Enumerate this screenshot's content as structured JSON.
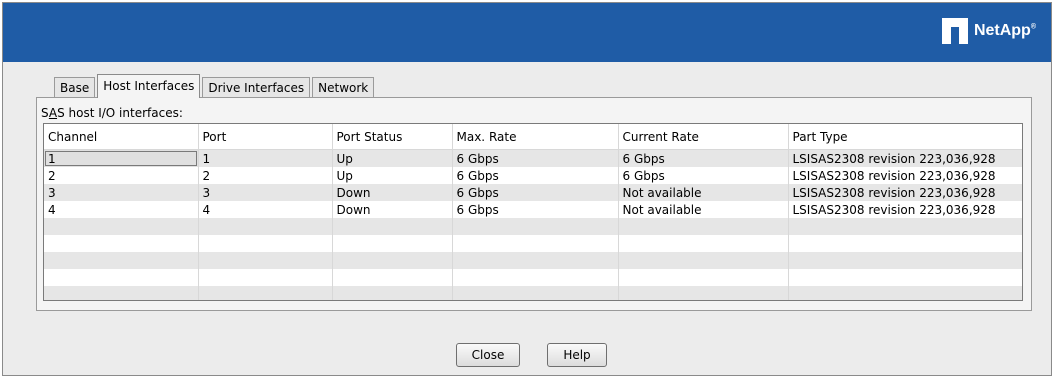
{
  "brand": {
    "name": "NetApp",
    "mark": "®"
  },
  "tabs": [
    {
      "label": "Base",
      "active": false
    },
    {
      "label": "Host Interfaces",
      "active": true
    },
    {
      "label": "Drive Interfaces",
      "active": false
    },
    {
      "label": "Network",
      "active": false
    }
  ],
  "section": {
    "label_prefix": "S",
    "label_underlined": "A",
    "label_rest": "S host I/O interfaces:"
  },
  "table": {
    "columns": [
      "Channel",
      "Port",
      "Port Status",
      "Max. Rate",
      "Current Rate",
      "Part Type"
    ],
    "rows": [
      [
        "1",
        "1",
        "Up",
        "6 Gbps",
        "6 Gbps",
        "LSISAS2308  revision 223,036,928"
      ],
      [
        "2",
        "2",
        "Up",
        "6 Gbps",
        "6 Gbps",
        "LSISAS2308  revision 223,036,928"
      ],
      [
        "3",
        "3",
        "Down",
        "6 Gbps",
        "Not available",
        "LSISAS2308  revision 223,036,928"
      ],
      [
        "4",
        "4",
        "Down",
        "6 Gbps",
        "Not available",
        "LSISAS2308  revision 223,036,928"
      ]
    ]
  },
  "buttons": {
    "close": "Close",
    "help": "Help"
  },
  "colors": {
    "header": "#1f5ca6"
  }
}
